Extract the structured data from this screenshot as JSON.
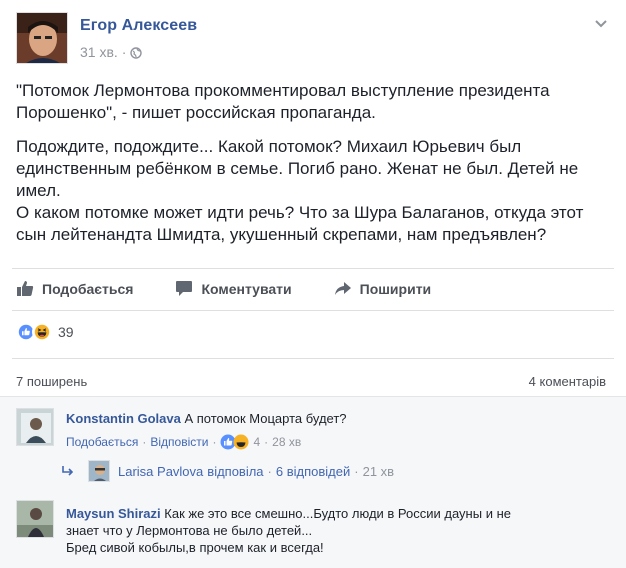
{
  "post": {
    "author": "Егор Алексеев",
    "time": "31 хв.",
    "separator": "·",
    "paragraphs": [
      "\"Потомок Лермонтова прокомментировал выступление президента Порошенко\", - пишет российская пропаганда.",
      "Подождите, подождите... Какой потомок? Михаил Юрьевич был единственным ребёнком в семье. Погиб рано. Женат не был. Детей не имел.",
      "О каком потомке может идти речь? Что за Шура Балаганов, откуда этот сын лейтенандта Шмидта, укушенный скрепами, нам предъявлен?"
    ]
  },
  "actions": {
    "like": "Подобається",
    "comment": "Коментувати",
    "share": "Поширити"
  },
  "reactions": {
    "count": "39",
    "like_color": "#5890ff",
    "haha_color": "#f7b125"
  },
  "stats": {
    "shares": "7 поширень",
    "comments": "4 коментарів"
  },
  "comments": [
    {
      "name": "Konstantin Golava",
      "text": "А потомок Моцарта будет?",
      "like_label": "Подобається",
      "reply_label": "Відповісти",
      "reaction_count": "4",
      "time": "28 хв",
      "reply": {
        "name": "Larisa Pavlova",
        "action": "відповіла",
        "replies": "6 відповідей",
        "time": "21 хв"
      }
    },
    {
      "name": "Maysun Shirazi",
      "text_line1": "Как же это все смешно...Будто люди в России дауны и не",
      "text_line2": "знает что у Лермонтова не было детей...",
      "text_line3": "Бред сивой кобылы,в прочем как и всегда!"
    }
  ]
}
